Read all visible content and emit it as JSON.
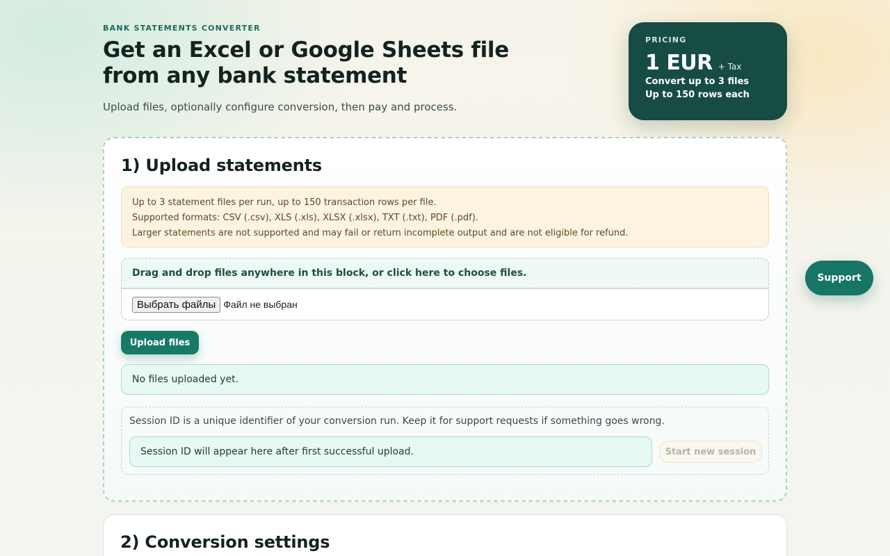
{
  "header": {
    "eyebrow": "BANK STATEMENTS CONVERTER",
    "title_line1": "Get an Excel or Google Sheets file",
    "title_line2": "from any bank statement",
    "subtitle": "Upload files, optionally configure conversion, then pay and process."
  },
  "pricing": {
    "label": "PRICING",
    "price": "1 EUR",
    "tax": "+ Tax",
    "line1": "Convert up to 3 files",
    "line2": "Up to 150 rows each"
  },
  "upload_section": {
    "title": "1) Upload statements",
    "notice_lines": [
      "Up to 3 statement files per run, up to 150 transaction rows per file.",
      "Supported formats: CSV (.csv), XLS (.xls), XLSX (.xlsx), TXT (.txt), PDF (.pdf).",
      "Larger statements are not supported and may fail or return incomplete output and are not eligible for refund."
    ],
    "dropzone_text": "Drag and drop files anywhere in this block, or click here to choose files.",
    "choose_files_label": "Выбрать файлы",
    "no_file_text": "Файл не выбран",
    "upload_button": "Upload files",
    "status_text": "No files uploaded yet.",
    "session_note": "Session ID is a unique identifier of your conversion run. Keep it for support requests if something goes wrong.",
    "session_placeholder": "Session ID will appear here after first successful upload.",
    "new_session_button": "Start new session"
  },
  "settings_section": {
    "title": "2) Conversion settings"
  },
  "support_button": "Support"
}
